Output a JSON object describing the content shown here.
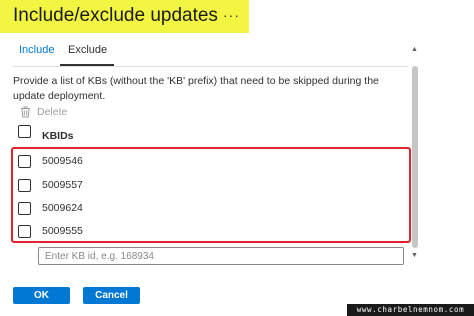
{
  "header": {
    "title": "Include/exclude updates",
    "more_glyph": "···"
  },
  "tabs": [
    {
      "label": "Include",
      "active": false
    },
    {
      "label": "Exclude",
      "active": true
    }
  ],
  "description": "Provide a list of KBs (without the 'KB' prefix) that need to be skipped during the update deployment.",
  "toolbar": {
    "delete_label": "Delete",
    "delete_icon": "trash-icon"
  },
  "table": {
    "header": "KBIDs",
    "rows": [
      "5009546",
      "5009557",
      "5009624",
      "5009555"
    ]
  },
  "input": {
    "placeholder": "Enter KB id, e.g. 168934",
    "value": ""
  },
  "buttons": {
    "ok": "OK",
    "cancel": "Cancel"
  },
  "watermark": "www.charbelnemnom.com",
  "colors": {
    "title_highlight": "#f2f542",
    "accent": "#0078d4",
    "annotation_box": "#e0232c"
  }
}
